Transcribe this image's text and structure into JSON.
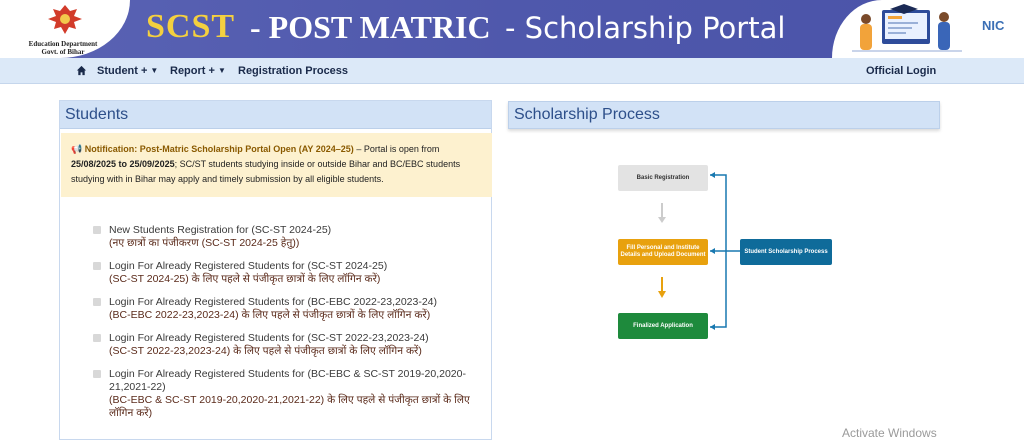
{
  "header": {
    "department_line1": "Education Department",
    "department_line2": "Govt. of Bihar",
    "title_scst": "SCST",
    "title_post": "- POST MATRIC",
    "title_portal": "- Scholarship Portal",
    "nic": "NIC"
  },
  "nav": {
    "items": [
      "Student +",
      "Report +",
      "Registration Process"
    ],
    "official_login": "Official Login"
  },
  "students": {
    "heading": "Students",
    "notification": {
      "label": "Notification: Post-Matric Scholarship Portal Open (AY 2024–25)",
      "text1": " – Portal is open from ",
      "dates": "25/08/2025 to 25/09/2025",
      "text2": "; SC/ST students studying inside or outside Bihar and BC/EBC students studying with in Bihar may apply and timely submission by all eligible students."
    },
    "links": [
      {
        "en": "New Students Registration for (SC-ST 2024-25)",
        "hi": "(नए छात्रों का पंजीकरण (SC-ST 2024-25 हेतु))"
      },
      {
        "en": "Login For Already Registered Students for (SC-ST 2024-25)",
        "hi": "(SC-ST 2024-25) के लिए पहले से पंजीकृत छात्रों के लिए लॉगिन करें)"
      },
      {
        "en": "Login For Already Registered Students for (BC-EBC 2022-23,2023-24)",
        "hi": "(BC-EBC 2022-23,2023-24) के लिए पहले से पंजीकृत छात्रों के लिए लॉगिन करें)"
      },
      {
        "en": "Login For Already Registered Students for (SC-ST 2022-23,2023-24)",
        "hi": "(SC-ST 2022-23,2023-24) के लिए पहले से पंजीकृत छात्रों के लिए लॉगिन करें)"
      },
      {
        "en": "Login For Already Registered Students for (BC-EBC & SC-ST 2019-20,2020-21,2021-22)",
        "hi": "(BC-EBC & SC-ST 2019-20,2020-21,2021-22) के लिए पहले से पंजीकृत छात्रों के लिए लॉगिन करें)"
      }
    ]
  },
  "process": {
    "heading": "Scholarship Process",
    "step1": "Basic Registration",
    "step2": "Fill Personal and Institute Details and Upload Document",
    "step3": "Finalized Application",
    "side": "Student Scholarship Process",
    "colors": {
      "step1": "#e3e3e3",
      "step2": "#e8a10e",
      "step3": "#1e8a3c",
      "side": "#0f6b9a",
      "arrow": "#1878b0"
    }
  },
  "watermark": "Activate Windows"
}
